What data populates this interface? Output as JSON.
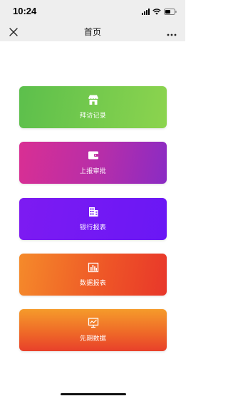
{
  "status_bar": {
    "time": "10:24"
  },
  "nav": {
    "title": "首页"
  },
  "cards": [
    {
      "label": "拜访记录",
      "icon": "store-icon"
    },
    {
      "label": "上报审批",
      "icon": "wallet-icon"
    },
    {
      "label": "银行报表",
      "icon": "building-icon"
    },
    {
      "label": "数据报表",
      "icon": "bar-chart-icon"
    },
    {
      "label": "先期数据",
      "icon": "monitor-chart-icon"
    }
  ],
  "colors": {
    "nav_background": "#eeeeee",
    "visit": [
      "#5cbf4c",
      "#8cd44e"
    ],
    "approval": [
      "#d92f93",
      "#8a2bc4"
    ],
    "bank": [
      "#7d1bf2",
      "#6a17f5"
    ],
    "data": [
      "#f58a2a",
      "#e8372a"
    ],
    "forward": [
      "#f59b2b",
      "#e8402a"
    ]
  }
}
